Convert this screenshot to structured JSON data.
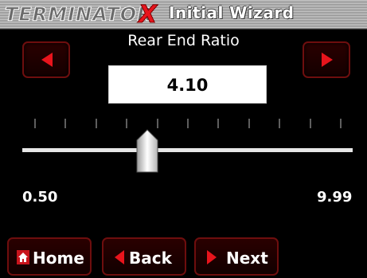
{
  "header": {
    "logo_text": "TERMINATOR X",
    "title": "Initial Wizard"
  },
  "screen": {
    "subtitle": "Rear End Ratio"
  },
  "controls": {
    "decrease_icon": "left-arrow-icon",
    "increase_icon": "right-arrow-icon"
  },
  "value": {
    "display": "4.10"
  },
  "slider": {
    "min_label": "0.50",
    "max_label": "9.99",
    "value": 4.1,
    "min": 0.5,
    "max": 9.99,
    "tick_count": 11
  },
  "footer": {
    "home_label": "Home",
    "back_label": "Back",
    "next_label": "Next",
    "home_icon": "home-icon",
    "back_icon": "back-arrow-icon",
    "next_icon": "next-arrow-icon"
  },
  "colors": {
    "accent_red": "#e8141c",
    "button_border": "#6e0e0e",
    "background": "#000000"
  }
}
